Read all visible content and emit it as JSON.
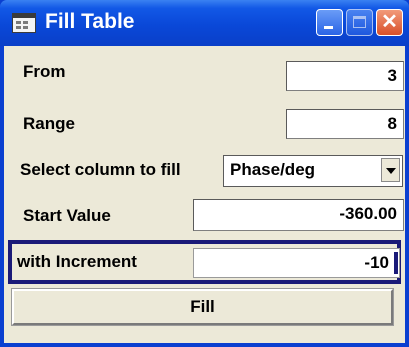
{
  "window": {
    "title": "Fill Table",
    "controls": [
      "minimize",
      "maximize",
      "close"
    ],
    "title_icon": "table-icon",
    "close_glyph": "✕"
  },
  "form": {
    "from": {
      "label": "From",
      "value": "3"
    },
    "range": {
      "label": "Range",
      "value": "8"
    },
    "column": {
      "label": "Select column to fill",
      "value": "Phase/deg"
    },
    "start_value": {
      "label": "Start Value",
      "value": "-360.00"
    },
    "increment": {
      "label": "with Increment",
      "value": "-10"
    },
    "fill_button": "Fill"
  },
  "colors": {
    "titlebar": "#0a48d8",
    "client_bg": "#ece9d8",
    "focus_border": "#1a1a78"
  }
}
